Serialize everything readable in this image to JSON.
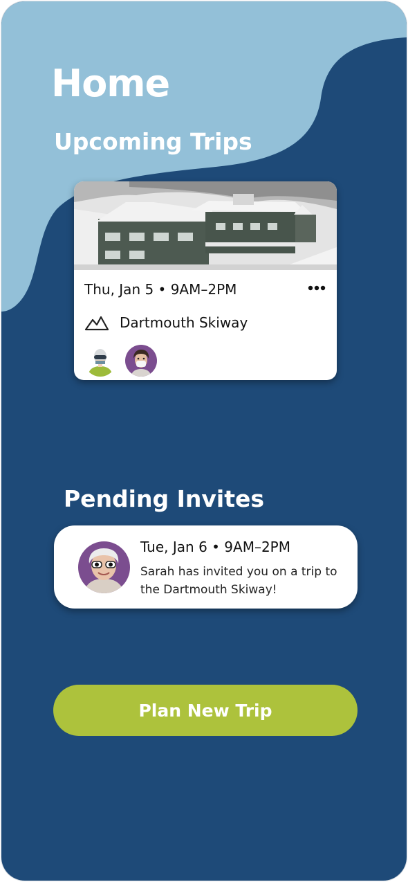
{
  "header": {
    "title": "Home"
  },
  "upcoming": {
    "section_title": "Upcoming Trips",
    "trip": {
      "date_time": "Thu, Jan 5 • 9AM–2PM",
      "location": "Dartmouth Skiway",
      "more_icon": "more-horizontal-icon",
      "location_icon": "mountain-icon",
      "participants": [
        "skier-avatar",
        "masked-person-avatar"
      ]
    }
  },
  "pending": {
    "section_title": "Pending Invites",
    "invite": {
      "date_time": "Tue, Jan 6 • 9AM–2PM",
      "message": "Sarah has invited you on a trip to the Dartmouth Skiway!"
    }
  },
  "actions": {
    "plan_label": "Plan New Trip"
  },
  "colors": {
    "background": "#1e4a78",
    "wave": "#93c0d8",
    "accent": "#adc23c",
    "card": "#ffffff"
  }
}
